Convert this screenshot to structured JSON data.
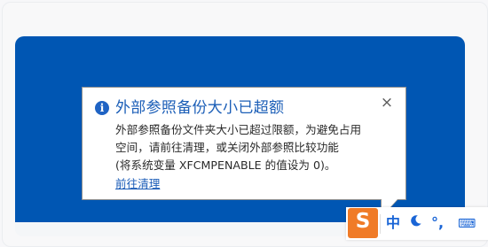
{
  "notification": {
    "title": "外部参照备份大小已超额",
    "body_lines": [
      "外部参照备份文件夹大小已超过限额，为避免占用",
      "空间，请前往清理，或关闭外部参照比较功能",
      "(将系统变量 XFCMPENABLE 的值设为 0)。"
    ],
    "link_label": "前往清理",
    "close_glyph": "×",
    "info_glyph": "i"
  },
  "ime": {
    "logo_glyph": "S",
    "mode_label": "中",
    "punct_label": "°,",
    "keyboard_label": "⌨"
  },
  "colors": {
    "panel_blue": "#0056b3",
    "title_blue": "#1b5eb7",
    "ime_orange": "#f07b27"
  }
}
